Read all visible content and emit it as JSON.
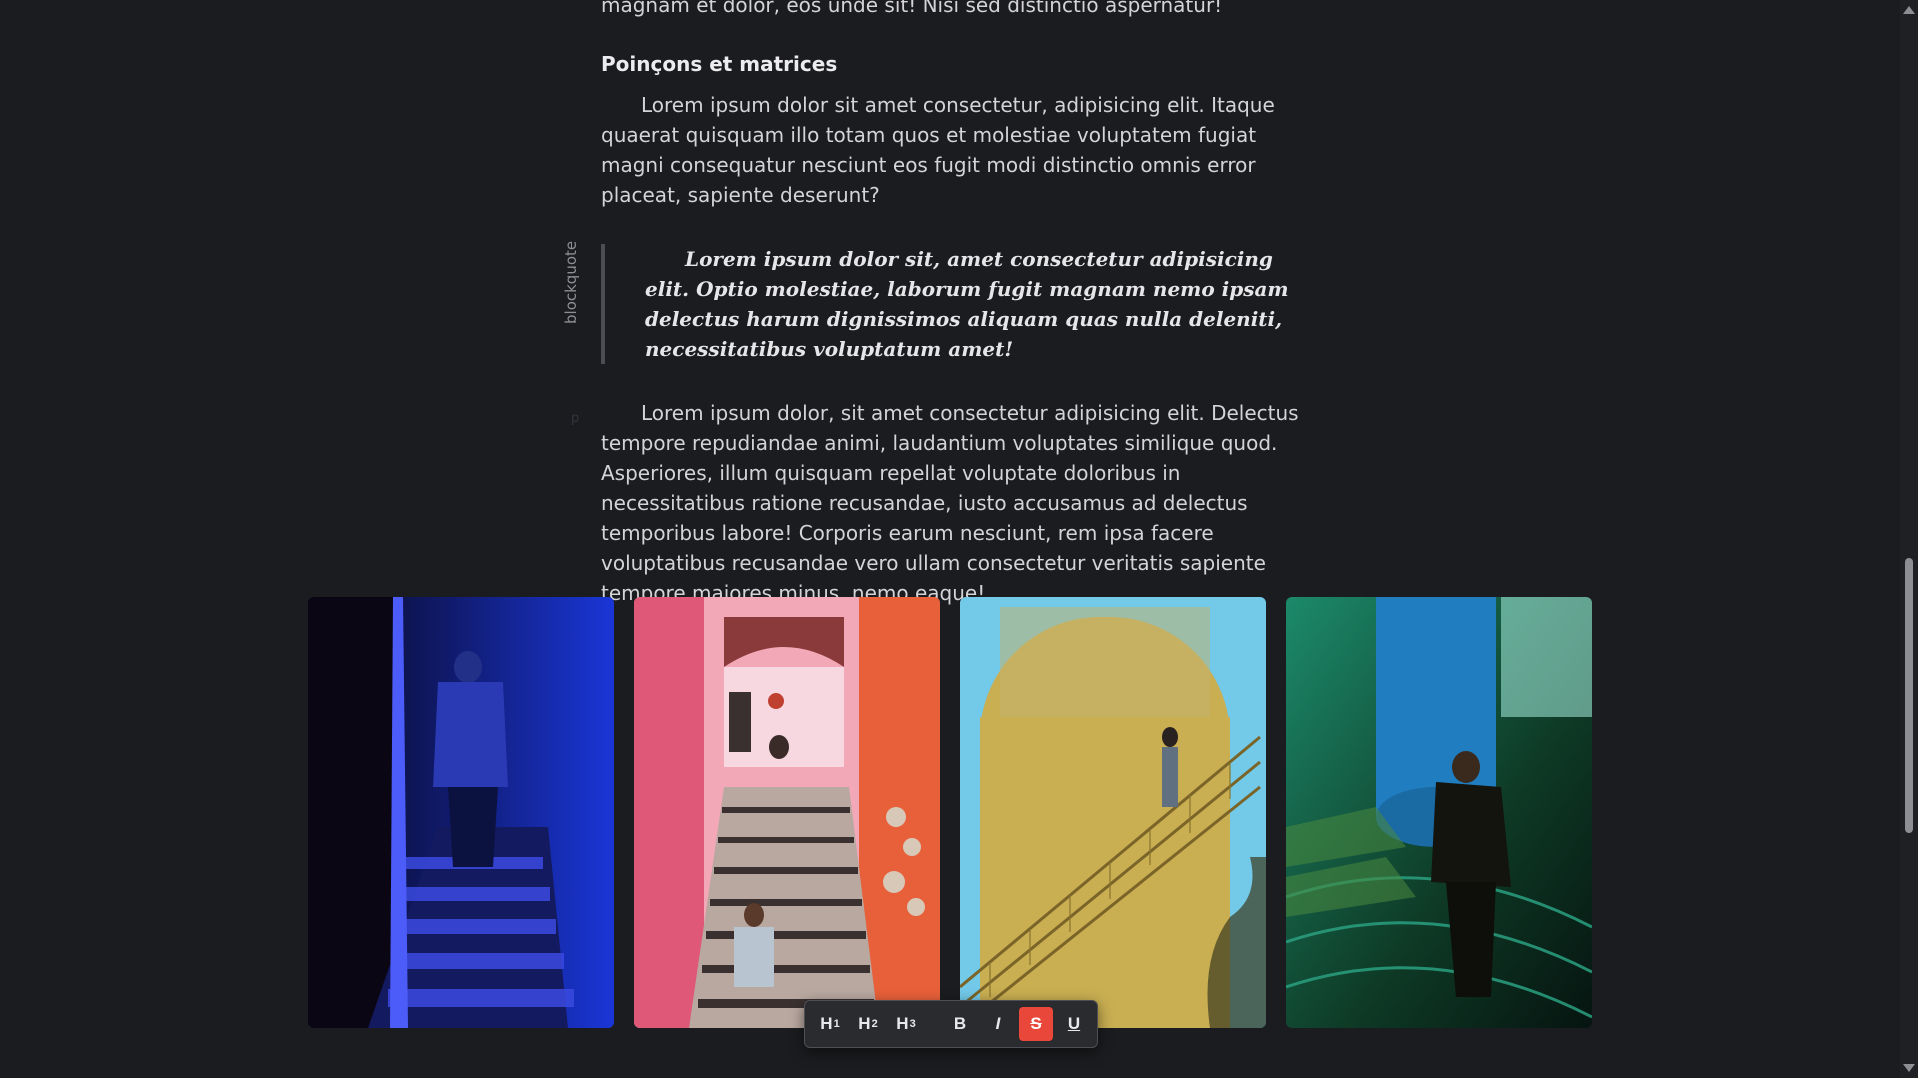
{
  "article": {
    "prev_tail": "magnam et dolor, eos unde sit! Nisi sed distinctio aspernatur!",
    "subheading": "Poinçons et matrices",
    "paragraph_1": "Lorem ipsum dolor sit amet consectetur, adipisicing elit. Itaque quaerat quisquam illo totam quos et molestiae voluptatem fugiat magni consequatur nesciunt eos fugit modi distinctio omnis error placeat, sapiente deserunt?",
    "blockquote_tag": "blockquote",
    "blockquote": "Lorem ipsum dolor sit, amet consectetur adipisicing elit. Optio molestiae, laborum fugit magnam nemo ipsam delectus harum dignissimos aliquam quas nulla deleniti, necessitatibus voluptatum amet!",
    "paragraph_tag": "p",
    "paragraph_2": "Lorem ipsum dolor, sit amet consectetur adipisicing elit. Delectus tempore repudiandae animi, laudantium voluptates similique quod. Asperiores, illum quisquam repellat voluptate doloribus in necessitatibus ratione recusandae, iusto accusamus ad delectus temporibus labore! Corporis earum nesciunt, rem ipsa facere voluptatibus recusandae vero ullam consectetur veritatis sapiente tempore maiores minus, nemo eaque!"
  },
  "gallery": {
    "photos": [
      {
        "name": "blue-stairs-man-photo",
        "colors": [
          "#0a0a2a",
          "#1530c8",
          "#5a3fd8"
        ]
      },
      {
        "name": "pink-stairway-photo",
        "colors": [
          "#e05878",
          "#f0a0b0",
          "#5a4a48"
        ]
      },
      {
        "name": "yellow-tower-stairs-photo",
        "colors": [
          "#6ec6e6",
          "#c8ae50",
          "#8a7430"
        ]
      },
      {
        "name": "spiral-staircase-photo",
        "colors": [
          "#0b2a22",
          "#1f8fc8",
          "#2c6a3a"
        ]
      }
    ]
  },
  "toolbar": {
    "h1": "H",
    "h1_sub": "1",
    "h2": "H",
    "h2_sub": "2",
    "h3": "H",
    "h3_sub": "3",
    "bold": "B",
    "italic": "I",
    "strike": "S",
    "underline": "U",
    "active_color": "#e8473a"
  }
}
